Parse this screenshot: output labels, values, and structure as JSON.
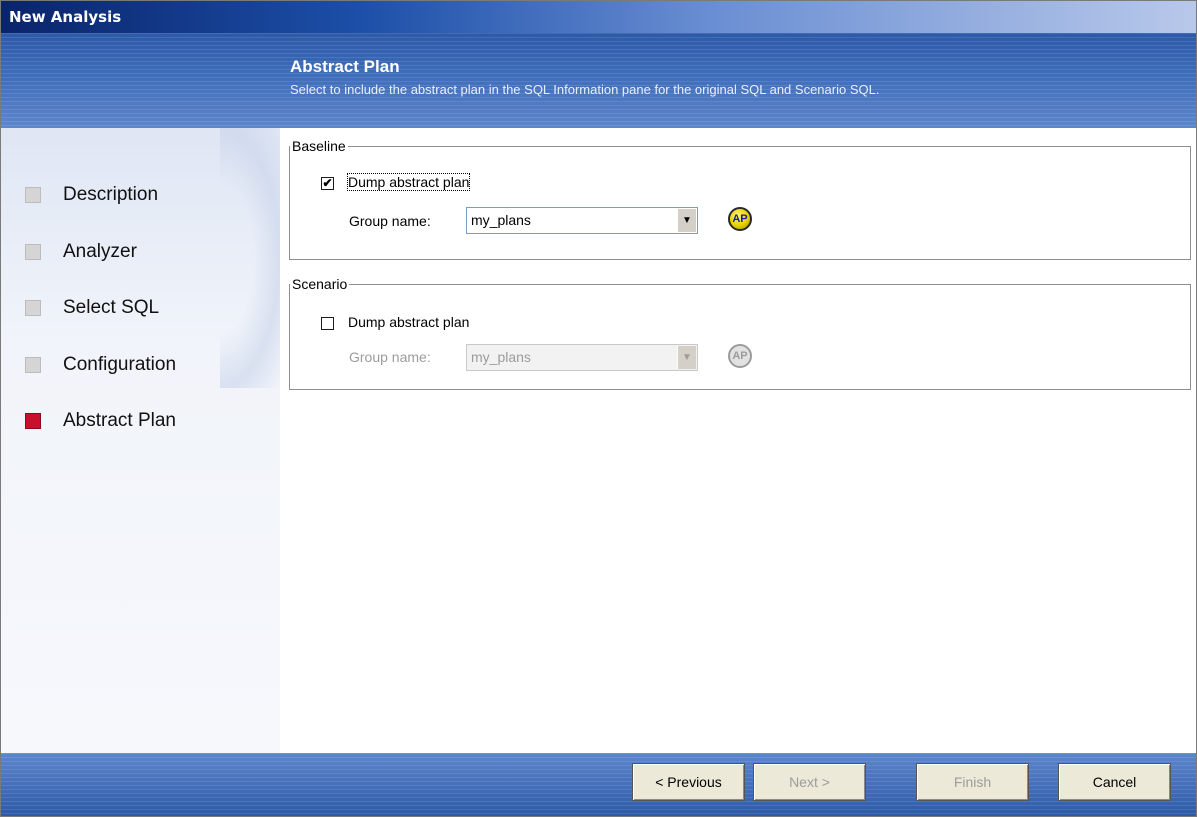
{
  "window": {
    "title": "New Analysis"
  },
  "header": {
    "title": "Abstract Plan",
    "subtitle": "Select to include the abstract plan in the SQL Information pane for the original SQL and Scenario SQL."
  },
  "steps": [
    {
      "label": "Description",
      "active": false
    },
    {
      "label": "Analyzer",
      "active": false
    },
    {
      "label": "Select SQL",
      "active": false
    },
    {
      "label": "Configuration",
      "active": false
    },
    {
      "label": "Abstract Plan",
      "active": true
    }
  ],
  "baseline": {
    "legend": "Baseline",
    "dump_label": "Dump abstract plan",
    "dump_checked": true,
    "group_label": "Group name:",
    "group_value": "my_plans",
    "icon_text": "AP"
  },
  "scenario": {
    "legend": "Scenario",
    "dump_label": "Dump abstract plan",
    "dump_checked": false,
    "group_label": "Group name:",
    "group_value": "my_plans",
    "icon_text": "AP"
  },
  "buttons": {
    "previous": "< Previous",
    "next": "Next >",
    "finish": "Finish",
    "cancel": "Cancel"
  },
  "colors": {
    "active_step": "#c8102e",
    "title_bar": "#0a246a"
  }
}
